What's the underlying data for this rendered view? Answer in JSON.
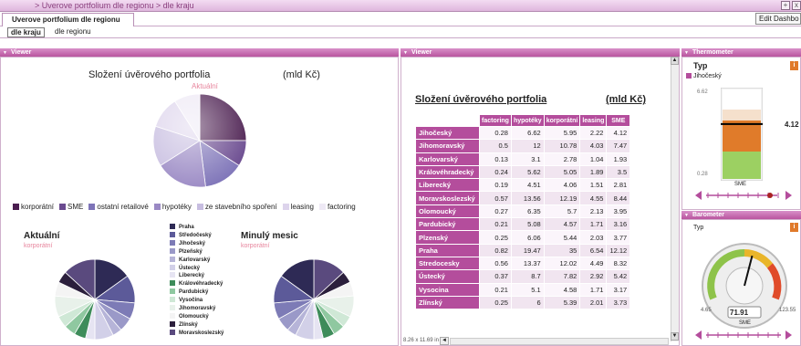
{
  "window": {
    "breadcrumb": "> Uverove portfolium dle regionu > dle kraju",
    "maximize_label": "+",
    "close_label": "x"
  },
  "tabs": {
    "active": "Uverove portfolium dle regionu",
    "edit_label": "Edit Dashbo"
  },
  "subtabs": [
    {
      "label": "dle kraju"
    },
    {
      "label": "dle regionu"
    }
  ],
  "panels": {
    "viewer_left": "Viewer",
    "viewer_mid": "Viewer",
    "thermometer": "Thermometer",
    "barometer": "Barometer"
  },
  "main_chart": {
    "title": "Složení úvěrového portfolia",
    "unit": "(mld Kč)",
    "subtitle": "Aktuální"
  },
  "legend": [
    {
      "label": "korporátní",
      "color": "#4a1d4f"
    },
    {
      "label": "SME",
      "color": "#6a4a8f"
    },
    {
      "label": "ostatní retailové",
      "color": "#7e74b8"
    },
    {
      "label": "hypotéky",
      "color": "#9a89c4"
    },
    {
      "label": "ze stavebního spoření",
      "color": "#c7bde0"
    },
    {
      "label": "leasing",
      "color": "#ddd4ec"
    },
    {
      "label": "factoring",
      "color": "#eee9f5"
    }
  ],
  "small_left": {
    "title": "Aktuální",
    "subtitle": "korporátní"
  },
  "small_right": {
    "title": "Minulý mesic",
    "subtitle": "korporátní"
  },
  "region_legend": [
    {
      "label": "Praha",
      "color": "#2e2a55"
    },
    {
      "label": "Středočeský",
      "color": "#5c5a99"
    },
    {
      "label": "Jihočeský",
      "color": "#7d7bb6"
    },
    {
      "label": "Plzeňský",
      "color": "#9a99c8"
    },
    {
      "label": "Karlovarský",
      "color": "#b6b4d8"
    },
    {
      "label": "Ústecký",
      "color": "#d2d0e8"
    },
    {
      "label": "Liberecký",
      "color": "#e6e4f2"
    },
    {
      "label": "Královéhradecký",
      "color": "#3e8c5a"
    },
    {
      "label": "Pardubický",
      "color": "#8fc8a0"
    },
    {
      "label": "Vysočina",
      "color": "#cfe8d6"
    },
    {
      "label": "Jihomoravský",
      "color": "#e8f1ea"
    },
    {
      "label": "Olomoucký",
      "color": "#f4f4f4"
    },
    {
      "label": "Zlínský",
      "color": "#2b1f3c"
    },
    {
      "label": "Moravskoslezský",
      "color": "#5a4a7e"
    }
  ],
  "table": {
    "title": "Složení úvěrového portfolia",
    "unit": "(mld Kč)",
    "columns": [
      "factoring",
      "hypotéky",
      "korporátní",
      "leasing",
      "SME"
    ],
    "rows": [
      {
        "name": "Jihočeský",
        "v": [
          "0.28",
          "6.62",
          "5.95",
          "2.22",
          "4.12"
        ]
      },
      {
        "name": "Jihomoravský",
        "v": [
          "0.5",
          "12",
          "10.78",
          "4.03",
          "7.47"
        ]
      },
      {
        "name": "Karlovarský",
        "v": [
          "0.13",
          "3.1",
          "2.78",
          "1.04",
          "1.93"
        ]
      },
      {
        "name": "Královéhradecký",
        "v": [
          "0.24",
          "5.62",
          "5.05",
          "1.89",
          "3.5"
        ]
      },
      {
        "name": "Liberecký",
        "v": [
          "0.19",
          "4.51",
          "4.06",
          "1.51",
          "2.81"
        ]
      },
      {
        "name": "Moravskoslezský",
        "v": [
          "0.57",
          "13.56",
          "12.19",
          "4.55",
          "8.44"
        ]
      },
      {
        "name": "Olomoucký",
        "v": [
          "0.27",
          "6.35",
          "5.7",
          "2.13",
          "3.95"
        ]
      },
      {
        "name": "Pardubický",
        "v": [
          "0.21",
          "5.08",
          "4.57",
          "1.71",
          "3.16"
        ]
      },
      {
        "name": "Plzenský",
        "v": [
          "0.25",
          "6.06",
          "5.44",
          "2.03",
          "3.77"
        ]
      },
      {
        "name": "Praha",
        "v": [
          "0.82",
          "19.47",
          "35",
          "6.54",
          "12.12"
        ]
      },
      {
        "name": "Stredocesky",
        "v": [
          "0.56",
          "13.37",
          "12.02",
          "4.49",
          "8.32"
        ]
      },
      {
        "name": "Ústecký",
        "v": [
          "0.37",
          "8.7",
          "7.82",
          "2.92",
          "5.42"
        ]
      },
      {
        "name": "Vysocina",
        "v": [
          "0.21",
          "5.1",
          "4.58",
          "1.71",
          "3.17"
        ]
      },
      {
        "name": "Zlínský",
        "v": [
          "0.25",
          "6",
          "5.39",
          "2.01",
          "3.73"
        ]
      }
    ],
    "status": "8.26 x 11.69 in"
  },
  "thermometer": {
    "title": "Typ",
    "region": "Jihočeský",
    "max": "6.62",
    "min": "0.28",
    "value": "4.12",
    "value_num": 4.12,
    "min_num": 0.28,
    "max_num": 6.62,
    "label": "SME"
  },
  "barometer": {
    "title": "Typ",
    "value": "71.91",
    "value_num": 71.91,
    "min_label": "4.65",
    "max_label": "123.55",
    "min_num": 4.65,
    "max_num": 123.55,
    "label": "SME"
  }
}
